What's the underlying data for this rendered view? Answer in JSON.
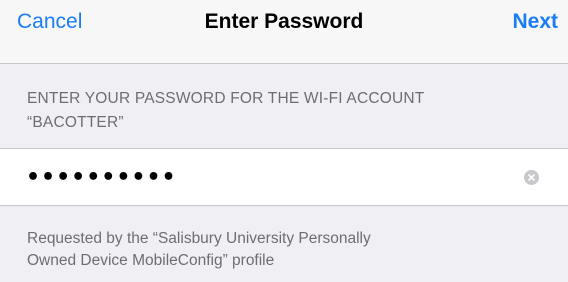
{
  "navbar": {
    "cancel_label": "Cancel",
    "title": "Enter Password",
    "next_label": "Next"
  },
  "prompt": {
    "line1": "ENTER YOUR PASSWORD FOR THE WI-FI ACCOUNT",
    "line2": "“BACOTTER”"
  },
  "password_field": {
    "value": "••••••••••",
    "clear_icon": "clear-x-circle-icon"
  },
  "footer": {
    "line1": "Requested by the “Salisbury University Personally",
    "line2": "Owned Device MobileConfig” profile"
  },
  "colors": {
    "accent": "#1a7df5",
    "background": "#efeff4",
    "secondary_text": "#6d6d72"
  }
}
